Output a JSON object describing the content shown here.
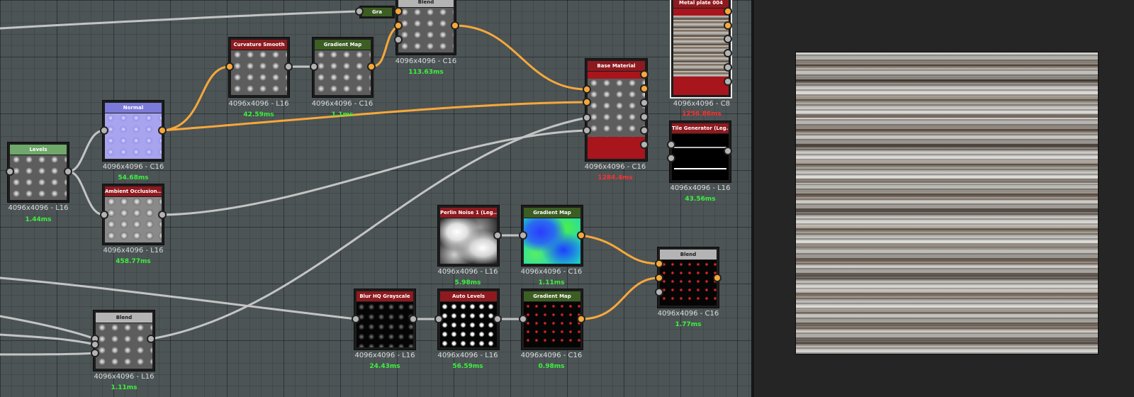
{
  "nodes": {
    "gra": {
      "title": "Gra"
    },
    "blend_top": {
      "title": "Blend",
      "res": "4096x4096 - C16",
      "time": "113.63ms"
    },
    "metal_plate": {
      "title": "Metal plate 004",
      "res": "4096x4096 - C8",
      "time": "1256.86ms"
    },
    "curvature": {
      "title": "Curvature Smooth",
      "res": "4096x4096 - L16",
      "time": "42.59ms"
    },
    "gradient_map_1": {
      "title": "Gradient Map",
      "res": "4096x4096 - C16",
      "time": "1.1ms"
    },
    "base_material": {
      "title": "Base Material",
      "res": "4096x4096 - C16",
      "time": "1284.4ms"
    },
    "normal": {
      "title": "Normal",
      "res": "4096x4096 - C16",
      "time": "54.68ms"
    },
    "tile_generator": {
      "title": "Tile Generator (Leg...",
      "res": "4096x4096 - L16",
      "time": "43.56ms"
    },
    "levels": {
      "title": "Levels",
      "res": "4096x4096 - L16",
      "time": "1.44ms"
    },
    "ambient_occlusion": {
      "title": "Ambient Occlusion...",
      "res": "4096x4096 - L16",
      "time": "458.77ms"
    },
    "perlin": {
      "title": "Perlin Noise 1 (Leg...",
      "res": "4096x4096 - L16",
      "time": "5.98ms"
    },
    "gradient_map_2": {
      "title": "Gradient Map",
      "res": "4096x4096 - C16",
      "time": "1.11ms"
    },
    "blend_right": {
      "title": "Blend",
      "res": "4096x4096 - C16",
      "time": "1.77ms"
    },
    "blur": {
      "title": "Blur HQ Grayscale",
      "res": "4096x4096 - L16",
      "time": "24.43ms"
    },
    "auto_levels": {
      "title": "Auto Levels",
      "res": "4096x4096 - L16",
      "time": "56.59ms"
    },
    "gradient_map_3": {
      "title": "Gradient Map",
      "res": "4096x4096 - C16",
      "time": "0.98ms"
    },
    "blend_bottom": {
      "title": "Blend",
      "res": "4096x4096 - L16",
      "time": "1.11ms"
    }
  },
  "colors": {
    "color_wire": "#f7a83b",
    "gray_wire": "#c4c4c4",
    "time_ok": "#3df23d",
    "time_slow": "#ff3030",
    "header_red": "#8e1a1f",
    "header_green": "#3d5e23"
  }
}
